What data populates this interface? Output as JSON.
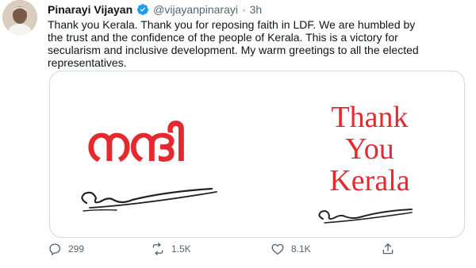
{
  "tweet": {
    "author_name": "Pinarayi Vijayan",
    "handle": "@vijayanpinarayi",
    "separator": "·",
    "time": "3h",
    "text": "Thank you Kerala. Thank you for reposing faith in LDF. We are humbled by\nthe trust and the confidence of the people of Kerala. This is a victory for\nsecularism and inclusive development. My warm greetings to all the elected\nrepresentatives.",
    "media": {
      "malayalam_text": "നന്ദി",
      "english_lines": [
        "Thank",
        "You",
        "Kerala"
      ],
      "accent_color": "#e52a2f"
    },
    "actions": {
      "replies": "299",
      "retweets": "1.5K",
      "likes": "8.1K"
    }
  },
  "colors": {
    "text_primary": "#0f1419",
    "text_secondary": "#536471",
    "verified_blue": "#1d9bf0",
    "border": "#cfd9de"
  },
  "icons": [
    "verified-badge-icon",
    "reply-icon",
    "retweet-icon",
    "like-icon",
    "share-icon"
  ]
}
